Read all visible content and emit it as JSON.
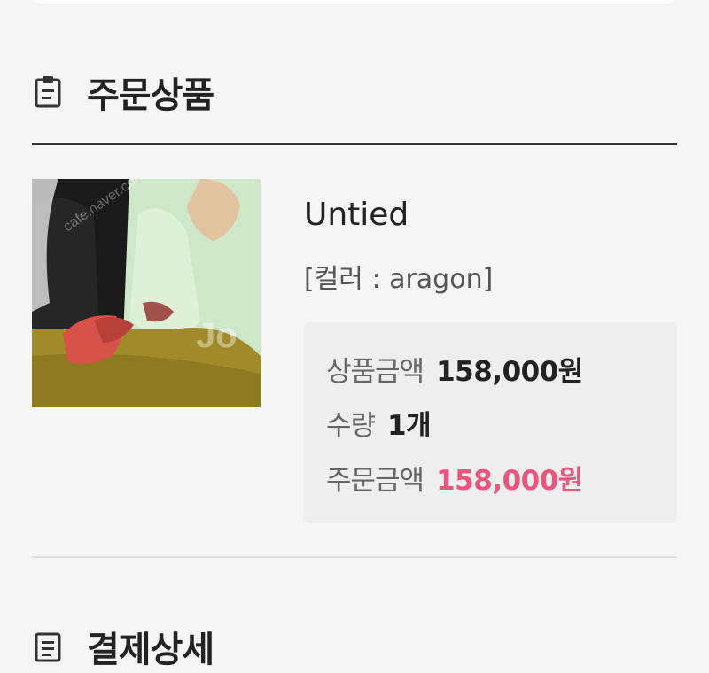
{
  "order_section": {
    "title": "주문상품",
    "icon": "clipboard-icon"
  },
  "product": {
    "name": "Untied",
    "option": "[컬러 : aragon]",
    "image_alt": "product photo",
    "watermark_texts": [
      "cafe.naver.com/joonggonara",
      "Joonggonara"
    ]
  },
  "price_summary": {
    "product_amount_label": "상품금액",
    "product_amount_value": "158,000원",
    "quantity_label": "수량",
    "quantity_value": "1개",
    "order_amount_label": "주문금액",
    "order_amount_value": "158,000원"
  },
  "payment_section": {
    "title": "결제상세",
    "icon": "receipt-icon"
  },
  "colors": {
    "accent": "#e8557d",
    "text": "#222222",
    "muted": "#666666",
    "box_bg": "#eeeeee"
  }
}
